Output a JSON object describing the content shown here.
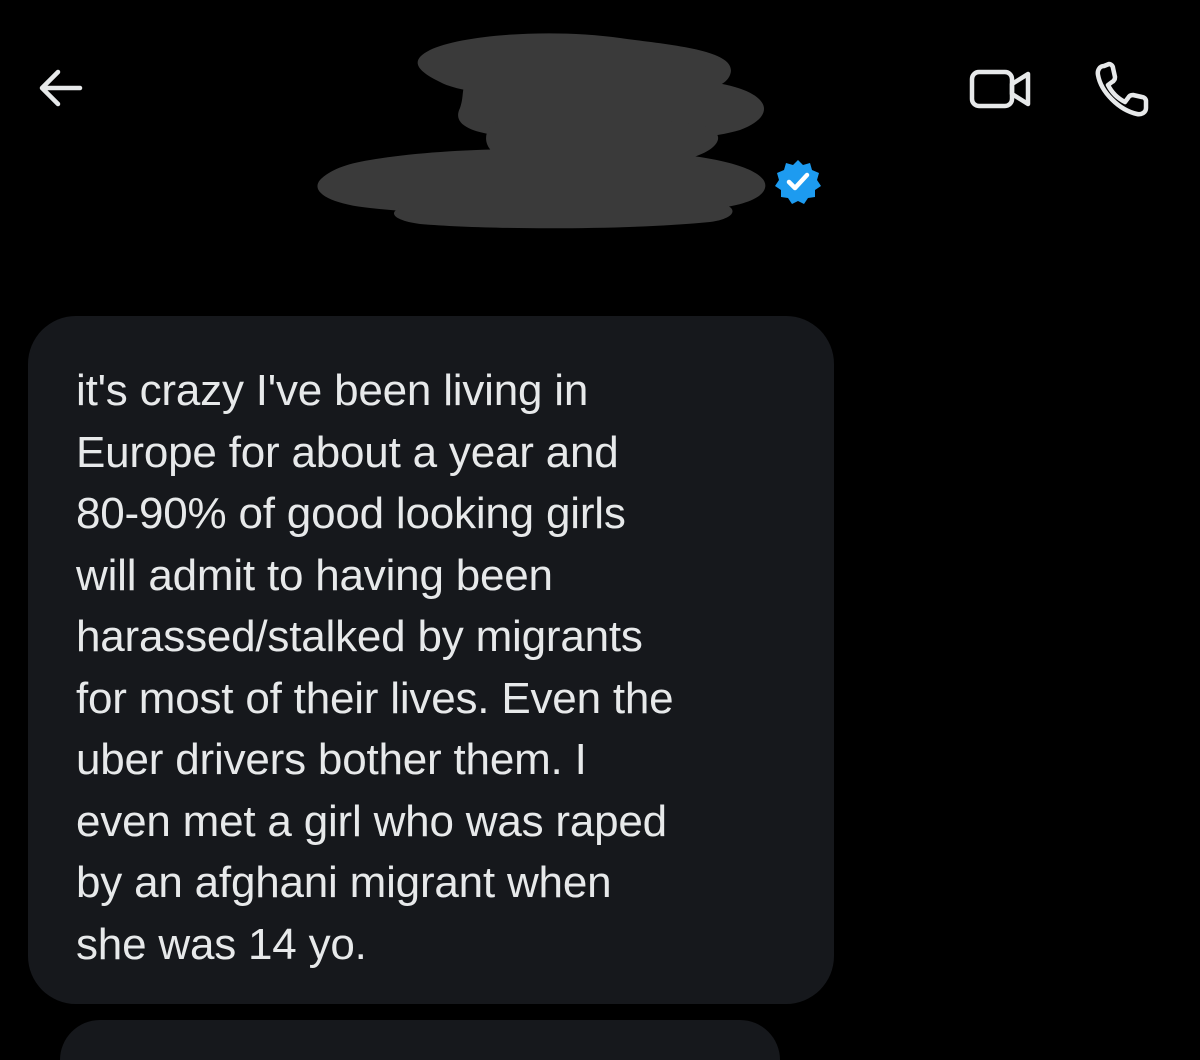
{
  "header": {
    "back_icon": "arrow-left-icon",
    "contact_name": "",
    "verified_badge_icon": "verified-check-icon",
    "video_call_icon": "video-camera-icon",
    "voice_call_icon": "phone-icon"
  },
  "message": {
    "text": "it's crazy I've been living in\nEurope for about a year and\n80-90% of good looking girls\nwill admit to having been\nharassed/stalked by migrants\nfor most of their lives. Even the\nuber drivers bother them. I\neven met a girl who was raped\nby an afghani migrant when\nshe was 14 yo."
  },
  "colors": {
    "background": "#000000",
    "bubble": "#16181c",
    "text": "#e7e9ea",
    "verified": "#1d9bf0",
    "redaction": "#3a3a3a"
  }
}
